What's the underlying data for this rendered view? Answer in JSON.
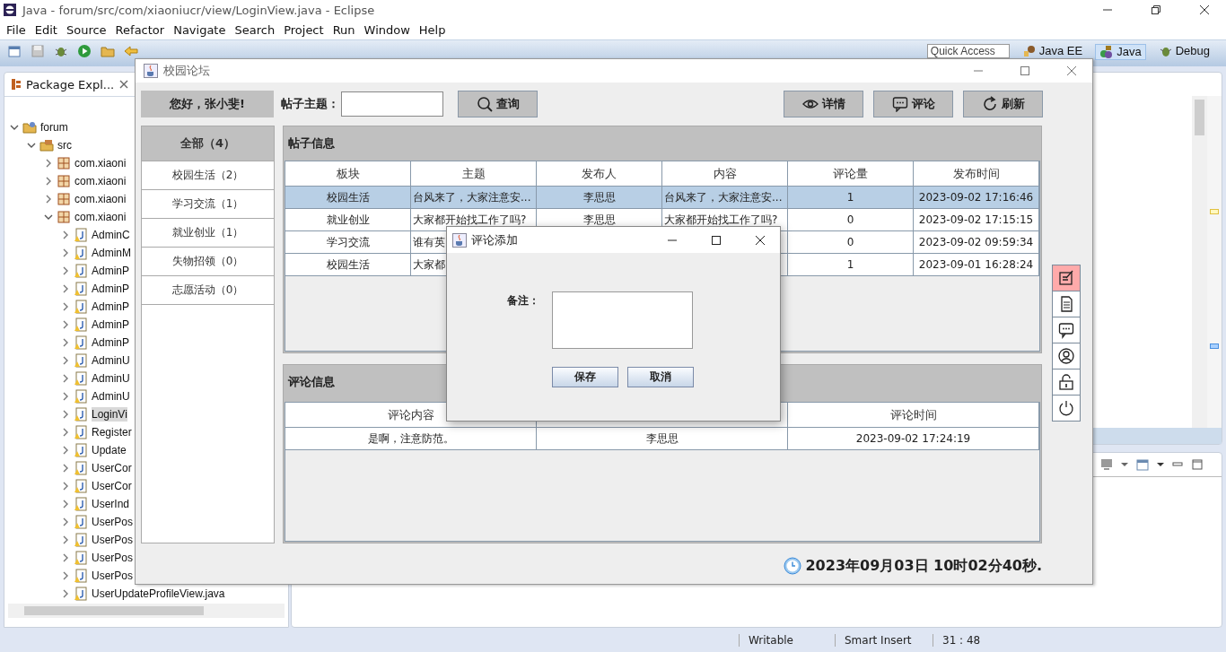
{
  "eclipse": {
    "title": "Java - forum/src/com/xiaoniucr/view/LoginView.java - Eclipse",
    "menu": [
      "File",
      "Edit",
      "Source",
      "Refactor",
      "Navigate",
      "Search",
      "Project",
      "Run",
      "Window",
      "Help"
    ],
    "quick_access": "Quick Access",
    "perspectives": [
      {
        "kind": "javaee",
        "label": "Java EE",
        "selected": false
      },
      {
        "kind": "java",
        "label": "Java",
        "selected": true
      },
      {
        "kind": "debug",
        "label": "Debug",
        "selected": false
      }
    ],
    "explorer": {
      "tab": "Package Expl...",
      "tree": [
        {
          "kind": "project",
          "label": "forum",
          "expanded": true,
          "selected": false,
          "children": [
            {
              "kind": "source",
              "label": "src",
              "expanded": true,
              "selected": false,
              "children": [
                {
                  "kind": "package",
                  "label": "com.xiaoni",
                  "expanded": false,
                  "selected": false
                },
                {
                  "kind": "package",
                  "label": "com.xiaoni",
                  "expanded": false,
                  "selected": false
                },
                {
                  "kind": "package",
                  "label": "com.xiaoni",
                  "expanded": false,
                  "selected": false
                },
                {
                  "kind": "package",
                  "label": "com.xiaoni",
                  "expanded": true,
                  "selected": false,
                  "children": [
                    {
                      "kind": "file",
                      "label": "AdminC",
                      "expanded": false,
                      "selected": false
                    },
                    {
                      "kind": "file",
                      "label": "AdminM",
                      "expanded": false,
                      "selected": false
                    },
                    {
                      "kind": "file",
                      "label": "AdminP",
                      "expanded": false,
                      "selected": false
                    },
                    {
                      "kind": "file",
                      "label": "AdminP",
                      "expanded": false,
                      "selected": false
                    },
                    {
                      "kind": "file",
                      "label": "AdminP",
                      "expanded": false,
                      "selected": false
                    },
                    {
                      "kind": "file",
                      "label": "AdminP",
                      "expanded": false,
                      "selected": false
                    },
                    {
                      "kind": "file",
                      "label": "AdminP",
                      "expanded": false,
                      "selected": false
                    },
                    {
                      "kind": "file",
                      "label": "AdminU",
                      "expanded": false,
                      "selected": false
                    },
                    {
                      "kind": "file",
                      "label": "AdminU",
                      "expanded": false,
                      "selected": false
                    },
                    {
                      "kind": "file",
                      "label": "AdminU",
                      "expanded": false,
                      "selected": false
                    },
                    {
                      "kind": "file",
                      "label": "LoginVi",
                      "expanded": false,
                      "selected": true
                    },
                    {
                      "kind": "file",
                      "label": "Register",
                      "expanded": false,
                      "selected": false
                    },
                    {
                      "kind": "file",
                      "label": "Update",
                      "expanded": false,
                      "selected": false
                    },
                    {
                      "kind": "file",
                      "label": "UserCor",
                      "expanded": false,
                      "selected": false
                    },
                    {
                      "kind": "file",
                      "label": "UserCor",
                      "expanded": false,
                      "selected": false
                    },
                    {
                      "kind": "file",
                      "label": "UserInd",
                      "expanded": false,
                      "selected": false
                    },
                    {
                      "kind": "file",
                      "label": "UserPos",
                      "expanded": false,
                      "selected": false
                    },
                    {
                      "kind": "file",
                      "label": "UserPos",
                      "expanded": false,
                      "selected": false
                    },
                    {
                      "kind": "file",
                      "label": "UserPos",
                      "expanded": false,
                      "selected": false
                    },
                    {
                      "kind": "file",
                      "label": "UserPos",
                      "expanded": false,
                      "selected": false
                    },
                    {
                      "kind": "file",
                      "label": "UserUpdateProfileView.java",
                      "expanded": false,
                      "selected": false
                    }
                  ]
                }
              ]
            }
          ]
        }
      ]
    },
    "status_bar": [
      "Writable",
      "Smart Insert",
      "31 : 48"
    ]
  },
  "forum": {
    "title": "校园论坛",
    "greeting": "您好，张小斐!",
    "topic_label": "帖子主题：",
    "search_button": "查询",
    "actions": [
      {
        "kind": "view",
        "label": "详情"
      },
      {
        "kind": "comment",
        "label": "评论"
      },
      {
        "kind": "refresh",
        "label": "刷新"
      }
    ],
    "categories": [
      {
        "label": "全部（4）",
        "selected": true
      },
      {
        "label": "校园生活（2）",
        "selected": false
      },
      {
        "label": "学习交流（1）",
        "selected": false
      },
      {
        "label": "就业创业（1）",
        "selected": false
      },
      {
        "label": "失物招领（0）",
        "selected": false
      },
      {
        "label": "志愿活动（0）",
        "selected": false
      }
    ],
    "posts": {
      "title": "帖子信息",
      "columns": [
        "板块",
        "主题",
        "发布人",
        "内容",
        "评论量",
        "发布时间"
      ],
      "rows": [
        {
          "section": "校园生活",
          "topic": "台风来了，大家注意安...",
          "author": "李思思",
          "content": "台风来了，大家注意安...",
          "comments": "1",
          "time": "2023-09-02 17:16:46",
          "selected": true
        },
        {
          "section": "就业创业",
          "topic": "大家都开始找工作了吗?",
          "author": "李思思",
          "content": "大家都开始找工作了吗?",
          "comments": "0",
          "time": "2023-09-02 17:15:15",
          "selected": false
        },
        {
          "section": "学习交流",
          "topic": "谁有英",
          "comments": "0",
          "time": "2023-09-02 09:59:34",
          "selected": false
        },
        {
          "section": "校园生活",
          "topic": "大家都",
          "comments": "1",
          "time": "2023-09-01 16:28:24",
          "selected": false
        }
      ]
    },
    "comments": {
      "title": "评论信息",
      "columns": [
        {
          "label": "评论内容"
        },
        {},
        {
          "label": "评论时间"
        }
      ],
      "rows": [
        {
          "content": "是啊，注意防范。",
          "author": "李思思",
          "time": "2023-09-02 17:24:19"
        }
      ]
    },
    "side_tools": [
      {
        "kind": "edit",
        "selected": true
      },
      {
        "kind": "document",
        "selected": false
      },
      {
        "kind": "chat",
        "selected": false
      },
      {
        "kind": "user",
        "selected": false
      },
      {
        "kind": "lock",
        "selected": false
      },
      {
        "kind": "power",
        "selected": false
      }
    ],
    "clock": "2023年09月03日 10时02分40秒."
  },
  "dialog": {
    "title": "评论添加",
    "field_label": "备注：",
    "buttons": [
      "保存",
      "取消"
    ]
  }
}
